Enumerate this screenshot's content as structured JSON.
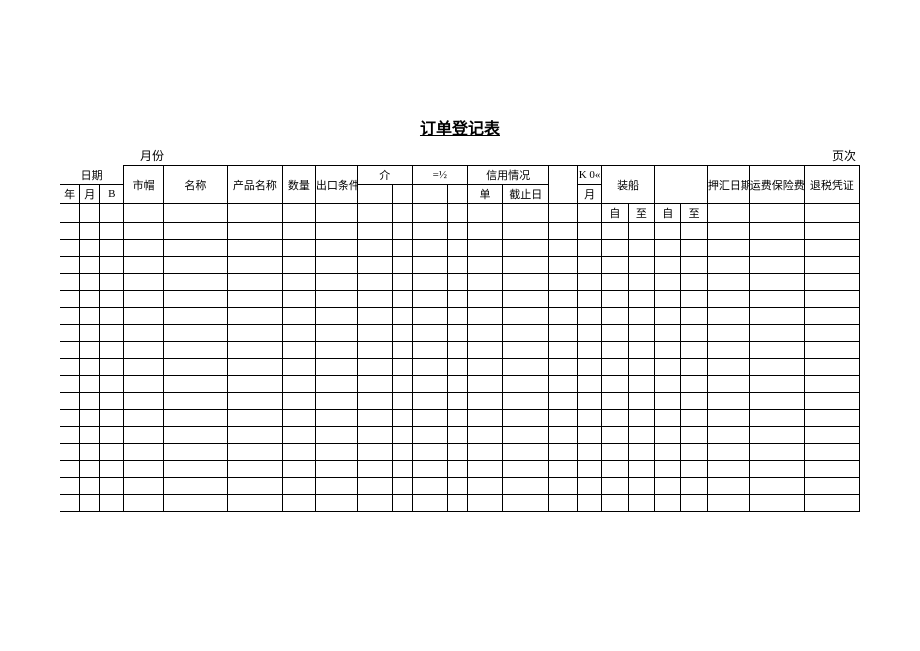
{
  "title": "订单登记表",
  "meta": {
    "month_label": "月份",
    "page_label": "页次"
  },
  "header": {
    "riqi": "日期",
    "shimao": "市帽",
    "mingcheng": "名称",
    "chanpin": "产品名称",
    "shuliang": "数量",
    "chukou": "出口条件",
    "jie": "介",
    "eqhalf": "=½",
    "xinyong": "信用情况",
    "k0": "K 0«",
    "yue_col": "月",
    "zhuangchuan": "装船",
    "yahui": "押汇日期",
    "yunfei": "运费保险费",
    "tuishui": "退税凭证",
    "nian": "年",
    "yue": "月",
    "b": "B",
    "dan": "单",
    "jiezhiri": "截止日",
    "zi": "自",
    "zhi": "至"
  },
  "empty_rows": 17,
  "cols_per_row": 23
}
